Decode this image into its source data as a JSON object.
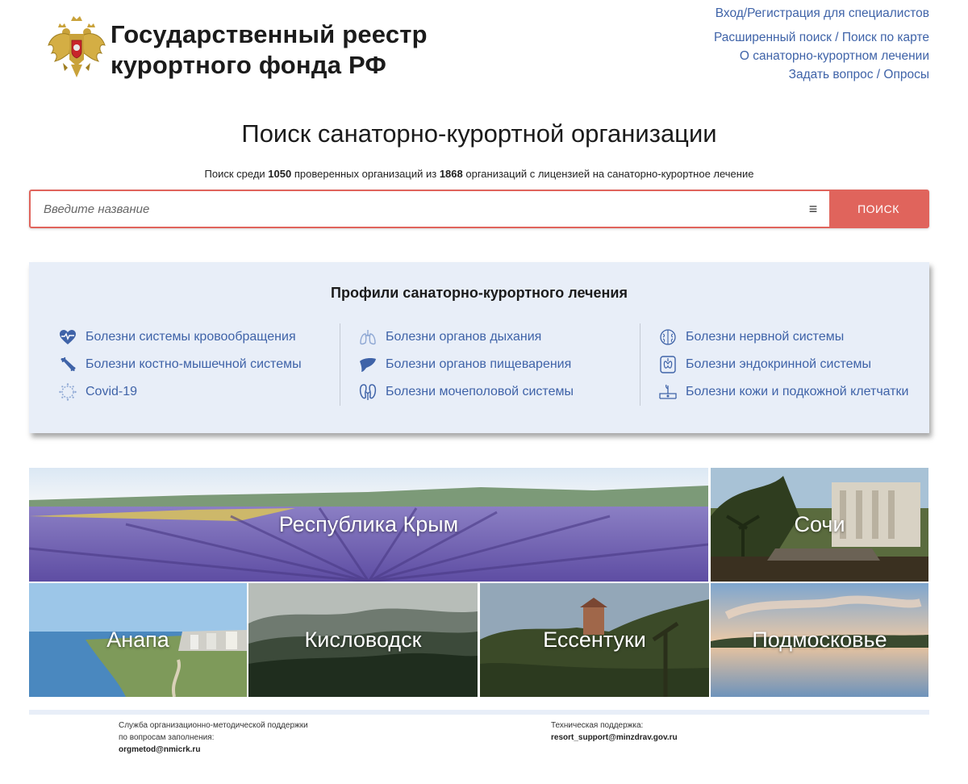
{
  "header": {
    "title_line1": "Государственный реестр",
    "title_line2": "курортного фонда РФ",
    "links": {
      "login": "Вход/Регистрация для специалистов",
      "advanced_search": "Расширенный поиск / Поиск по карте",
      "about": "О санаторно-курортном лечении",
      "question": "Задать вопрос / Опросы"
    }
  },
  "search": {
    "title": "Поиск санаторно-курортной организации",
    "sub_prefix": "Поиск среди",
    "verified_count": "1050",
    "sub_middle": "проверенных организаций из",
    "total_count": "1868",
    "sub_suffix": "организаций с лицензией на санаторно-курортное лечение",
    "placeholder": "Введите название",
    "button_label": "ПОИСК",
    "menu_glyph": "≡"
  },
  "profiles": {
    "title": "Профили санаторно-курортного лечения",
    "columns": [
      [
        {
          "label": "Болезни системы кровообращения",
          "icon": "heart-icon"
        },
        {
          "label": "Болезни костно-мышечной системы",
          "icon": "bone-icon"
        },
        {
          "label": "Covid-19",
          "icon": "virus-icon"
        }
      ],
      [
        {
          "label": "Болезни органов дыхания",
          "icon": "lungs-icon"
        },
        {
          "label": "Болезни органов пищеварения",
          "icon": "liver-icon"
        },
        {
          "label": "Болезни мочеполовой системы",
          "icon": "kidneys-icon"
        }
      ],
      [
        {
          "label": "Болезни нервной системы",
          "icon": "brain-icon"
        },
        {
          "label": "Болезни эндокринной системы",
          "icon": "thyroid-icon"
        },
        {
          "label": "Болезни кожи и подкожной клетчатки",
          "icon": "skin-icon"
        }
      ]
    ],
    "icon_color": "#3f63a8"
  },
  "regions": {
    "crimea": "Республика Крым",
    "sochi": "Сочи",
    "anapa": "Анапа",
    "kislovodsk": "Кисловодск",
    "essentuki": "Ессентуки",
    "podmoskovye": "Подмосковье"
  },
  "footer": {
    "org_line1": "Служба организационно-методической поддержки",
    "org_line2": "по вопросам заполнения:",
    "org_email": "orgmetod@nmicrk.ru",
    "tech_line1": "Техническая поддержка:",
    "tech_email": "resort_support@minzdrav.gov.ru"
  },
  "colors": {
    "accent": "#e0645c",
    "link": "#3f63a8",
    "panel": "#e8eef8"
  }
}
